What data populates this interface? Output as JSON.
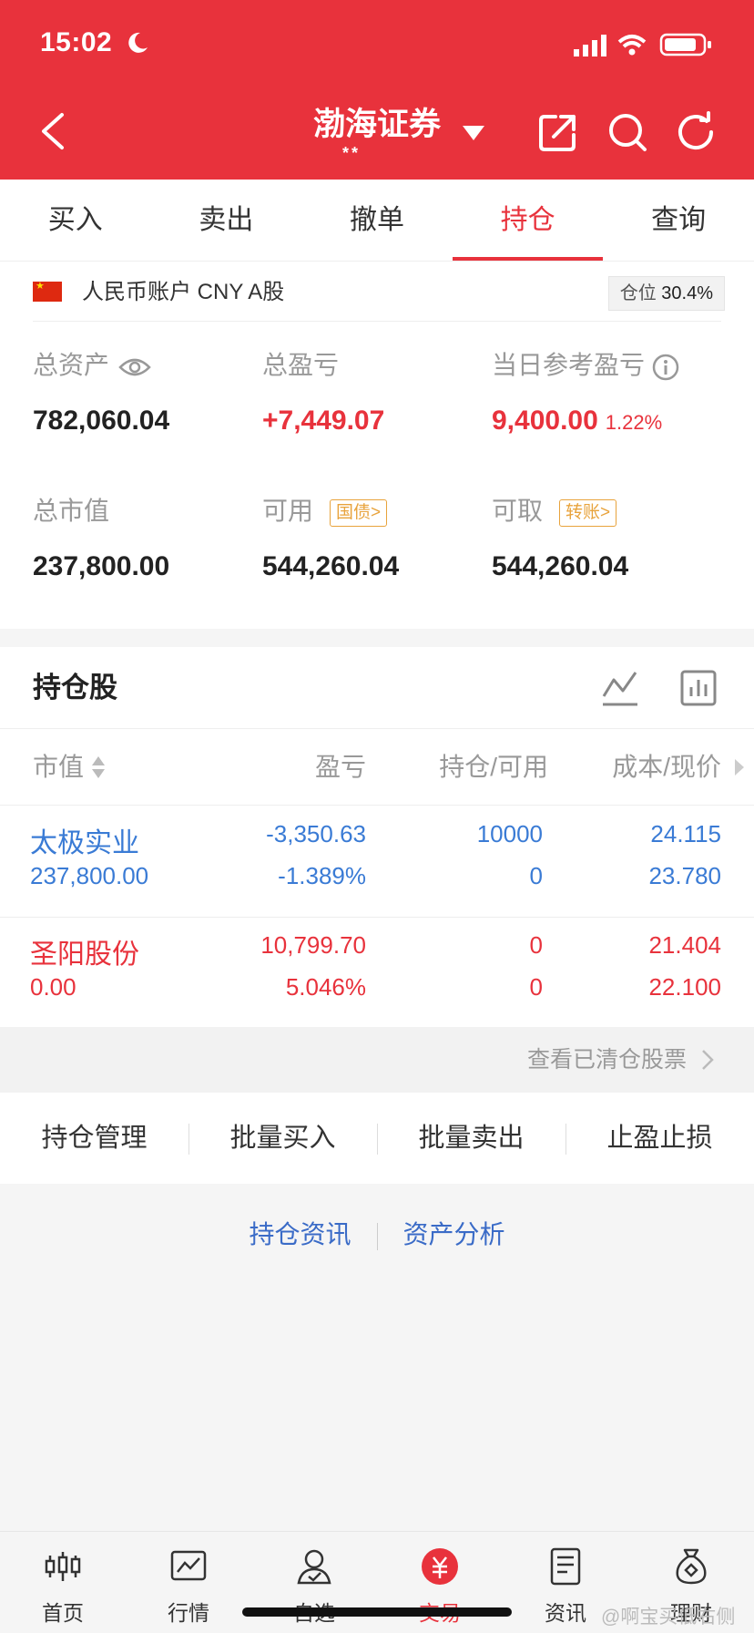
{
  "status": {
    "time": "15:02"
  },
  "header": {
    "title": "渤海证券",
    "subtitle": "**"
  },
  "tabs": [
    {
      "label": "买入"
    },
    {
      "label": "卖出"
    },
    {
      "label": "撤单"
    },
    {
      "label": "持仓",
      "active": true
    },
    {
      "label": "查询"
    }
  ],
  "account": {
    "label": "人民币账户 CNY A股",
    "position_label": "仓位",
    "position_value": "30.4%"
  },
  "metrics": {
    "total_assets": {
      "label": "总资产",
      "value": "782,060.04"
    },
    "total_pl": {
      "label": "总盈亏",
      "value": "+7,449.07"
    },
    "daily_pl": {
      "label": "当日参考盈亏",
      "value": "9,400.00",
      "pct": "1.22%"
    },
    "market_value": {
      "label": "总市值",
      "value": "237,800.00"
    },
    "available": {
      "label": "可用",
      "tag": "国债>",
      "value": "544,260.04"
    },
    "withdrawable": {
      "label": "可取",
      "tag": "转账>",
      "value": "544,260.04"
    }
  },
  "holdings": {
    "title": "持仓股",
    "columns": {
      "market_value": "市值",
      "pl": "盈亏",
      "qty": "持仓/可用",
      "price": "成本/现价"
    },
    "rows": [
      {
        "name": "太极实业",
        "market_value": "237,800.00",
        "pl": "-3,350.63",
        "pl_pct": "-1.389%",
        "qty": "10000",
        "available": "0",
        "cost": "24.115",
        "price": "23.780"
      },
      {
        "name": "圣阳股份",
        "market_value": "0.00",
        "pl": "10,799.70",
        "pl_pct": "5.046%",
        "qty": "0",
        "available": "0",
        "cost": "21.404",
        "price": "22.100"
      }
    ]
  },
  "cleared_link": "查看已清仓股票",
  "actions": [
    "持仓管理",
    "批量买入",
    "批量卖出",
    "止盈止损"
  ],
  "links": [
    "持仓资讯",
    "资产分析"
  ],
  "bottom_nav": [
    {
      "label": "首页",
      "icon": "candlestick-icon"
    },
    {
      "label": "行情",
      "icon": "chart-icon"
    },
    {
      "label": "自选",
      "icon": "user-check-icon"
    },
    {
      "label": "交易",
      "icon": "yuan-icon",
      "active": true
    },
    {
      "label": "资讯",
      "icon": "document-icon"
    },
    {
      "label": "理财",
      "icon": "money-bag-icon"
    }
  ],
  "watermark": "@啊宝买低右侧",
  "colors": {
    "brand": "#e8323c",
    "blue": "#3a7bd5",
    "tag": "#e8a33c"
  }
}
